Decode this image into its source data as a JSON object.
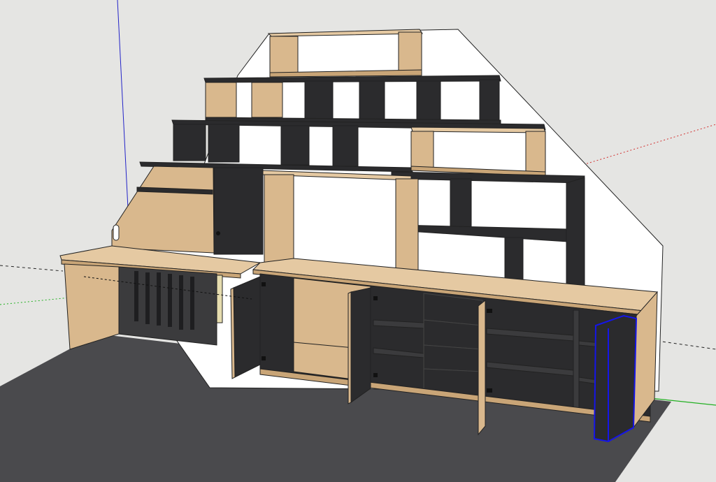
{
  "app": {
    "name": "",
    "viewport_background": "#e5e5e3"
  },
  "colors": {
    "wood": "#d9b88d",
    "wood_light": "#e5c9a2",
    "wood_dark": "#c9a577",
    "black": "#2b2b2d",
    "black_side": "#3b3b3d",
    "wall": "#ffffff",
    "floor": "#4a4a4d",
    "selection": "#1515e8",
    "axis_red": "#d23030",
    "axis_green": "#22b022",
    "axis_blue": "#2323c8"
  },
  "scene": {
    "model": "attic-storage-wall",
    "selected_component": "right-end-panel"
  }
}
